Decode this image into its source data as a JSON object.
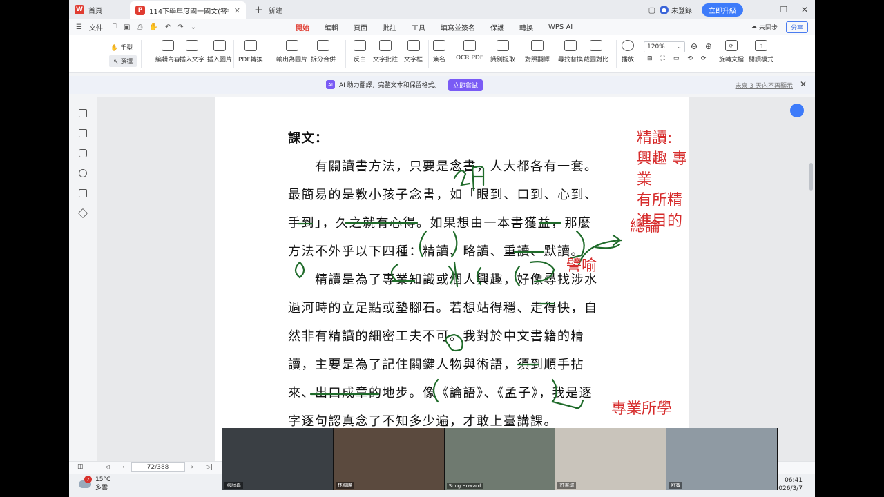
{
  "titlebar": {
    "home_tab": "首頁",
    "doc_tab": "114下學年度國一國文(答案)",
    "new_tab": "新建",
    "user": "未登錄",
    "upgrade": "立即升級"
  },
  "menurow": {
    "file": "文件",
    "menus": [
      "開始",
      "編輯",
      "頁面",
      "批註",
      "工具",
      "填寫並簽名",
      "保護",
      "轉換",
      "WPS AI"
    ],
    "active_index": 0,
    "sync": "未同步",
    "share": "分享"
  },
  "ribbon": {
    "hand": "手型",
    "select": "選擇",
    "tools": [
      "編輯內容",
      "插入文字",
      "插入圖片",
      "PDF轉換",
      "輸出為圖片",
      "拆分合併",
      "反白",
      "文字批註",
      "文字框",
      "簽名",
      "OCR PDF",
      "識別提取",
      "對照翻譯",
      "尋找替換",
      "截圖對比",
      "播放"
    ],
    "zoom": "120%",
    "right_tools": [
      "旋轉文檔",
      "閱讀模式"
    ]
  },
  "aibar": {
    "message": "AI 助力翻譯，完整文本和保留格式。",
    "try_button": "立即嘗試",
    "dismiss": "未來 3 天內不再顯示"
  },
  "document": {
    "title": "課文：",
    "lines": [
      "　　有關讀書方法，只要是念書，人大都各有一套。",
      "最簡易的是教小孩子念書，如「眼到、口到、心到、",
      "手到」，久之就有心得。如果想由一本書獲益，那麼",
      "方法不外乎以下四種：精讀、略讀、重讀、默讀。",
      "　　精讀是為了專業知識或個人興趣，好像尋找涉水",
      "過河時的立足點或墊腳石。若想站得穩、走得快，自",
      "然非有精讀的細密工夫不可。我對於中文書籍的精",
      "讀，主要是為了記住關鍵人物與術語，須到順手拈",
      "來、出口成章的地步。像《論語》、《孟子》，我是逐",
      "字逐句認真念了不知多少遍，才敢上臺講課。"
    ]
  },
  "annotations": {
    "note1": [
      "精讀:",
      "興趣 專業",
      "有所精進目的"
    ],
    "note2": "總論",
    "note3": "譬喻",
    "note4": "專業所學",
    "handwritten": "3月"
  },
  "status": {
    "page": "72/388"
  },
  "taskbar": {
    "badge": "7",
    "temp": "15°C",
    "weather": "多雲",
    "time": "06:41",
    "date": "2026/3/7"
  },
  "video": {
    "names": [
      "張庭嘉",
      "林珮晞",
      "Song Howard",
      "許書瑋",
      "舒寬"
    ]
  },
  "colors": {
    "accent_red": "#e03c31",
    "annotation_red": "#d62b2b",
    "ink_green": "#1f6b2a",
    "primary_blue": "#3d7bfa",
    "ai_purple": "#7a5bf5"
  }
}
